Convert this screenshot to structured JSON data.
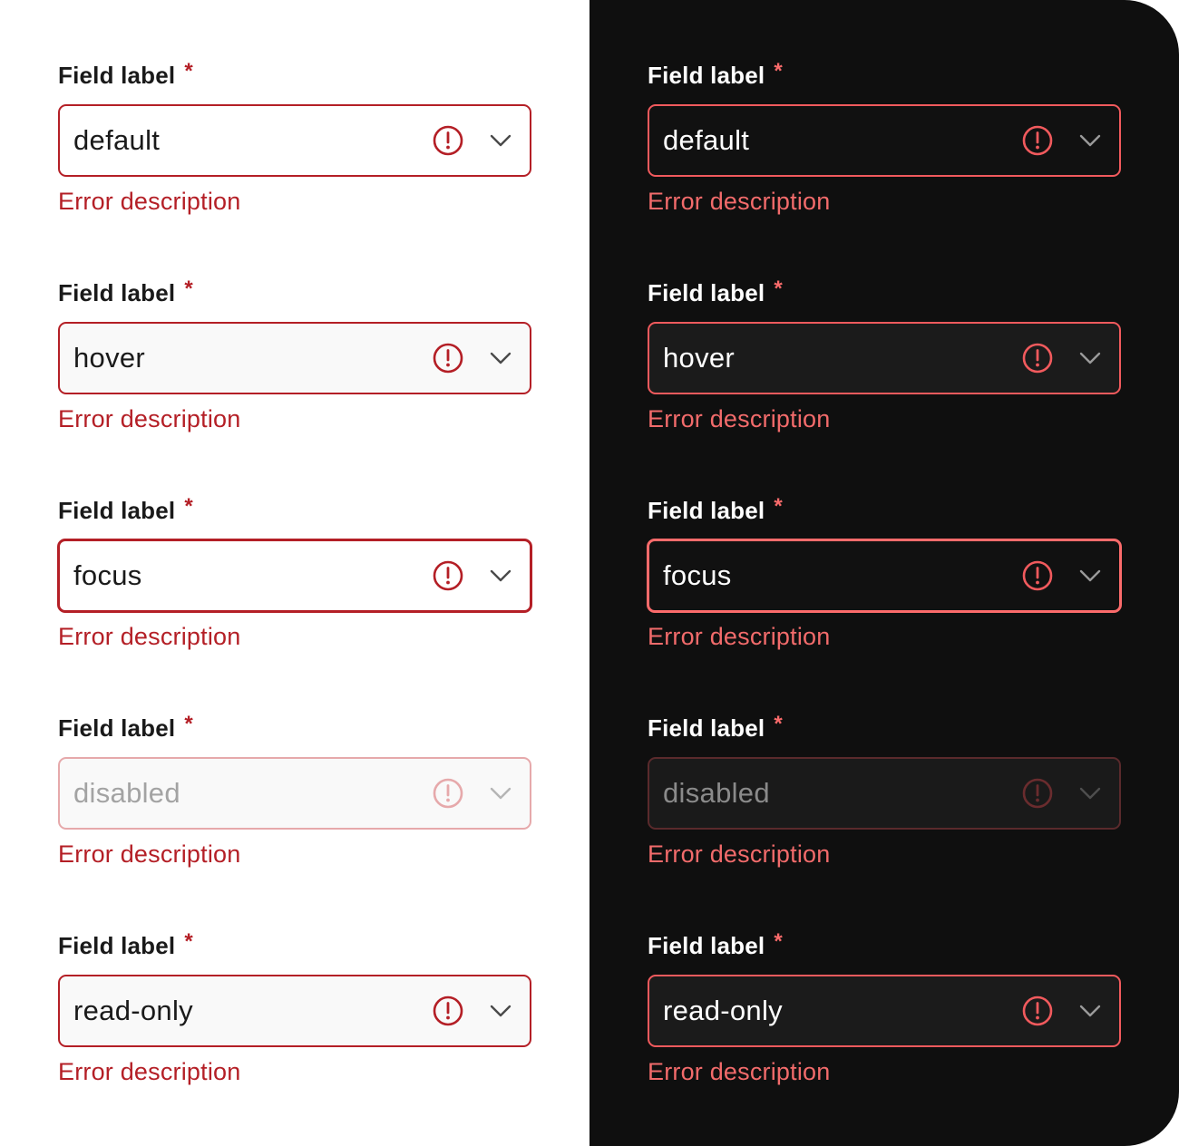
{
  "colors": {
    "light_error": "#b41f26",
    "light_error_disabled": "#e6a9ab",
    "dark_error": "#f15a5d",
    "dark_error_disabled": "#5a2a2c",
    "dark_background": "#0f0f0f"
  },
  "light": {
    "fields": [
      {
        "label": "Field label",
        "required_mark": "*",
        "value": "default",
        "error": "Error description",
        "icons": [
          "alert-circle-icon",
          "chevron-down-icon"
        ]
      },
      {
        "label": "Field label",
        "required_mark": "*",
        "value": "hover",
        "error": "Error description",
        "icons": [
          "alert-circle-icon",
          "chevron-down-icon"
        ]
      },
      {
        "label": "Field label",
        "required_mark": "*",
        "value": "focus",
        "error": "Error description",
        "icons": [
          "alert-circle-icon",
          "chevron-down-icon"
        ]
      },
      {
        "label": "Field label",
        "required_mark": "*",
        "value": "disabled",
        "error": "Error description",
        "icons": [
          "alert-circle-icon",
          "chevron-down-icon"
        ]
      },
      {
        "label": "Field label",
        "required_mark": "*",
        "value": "read-only",
        "error": "Error description",
        "icons": [
          "alert-circle-icon",
          "chevron-down-icon"
        ]
      }
    ]
  },
  "dark": {
    "fields": [
      {
        "label": "Field label",
        "required_mark": "*",
        "value": "default",
        "error": "Error description",
        "icons": [
          "alert-circle-icon",
          "chevron-down-icon"
        ]
      },
      {
        "label": "Field label",
        "required_mark": "*",
        "value": "hover",
        "error": "Error description",
        "icons": [
          "alert-circle-icon",
          "chevron-down-icon"
        ]
      },
      {
        "label": "Field label",
        "required_mark": "*",
        "value": "focus",
        "error": "Error description",
        "icons": [
          "alert-circle-icon",
          "chevron-down-icon"
        ]
      },
      {
        "label": "Field label",
        "required_mark": "*",
        "value": "disabled",
        "error": "Error description",
        "icons": [
          "alert-circle-icon",
          "chevron-down-icon"
        ]
      },
      {
        "label": "Field label",
        "required_mark": "*",
        "value": "read-only",
        "error": "Error description",
        "icons": [
          "alert-circle-icon",
          "chevron-down-icon"
        ]
      }
    ]
  }
}
